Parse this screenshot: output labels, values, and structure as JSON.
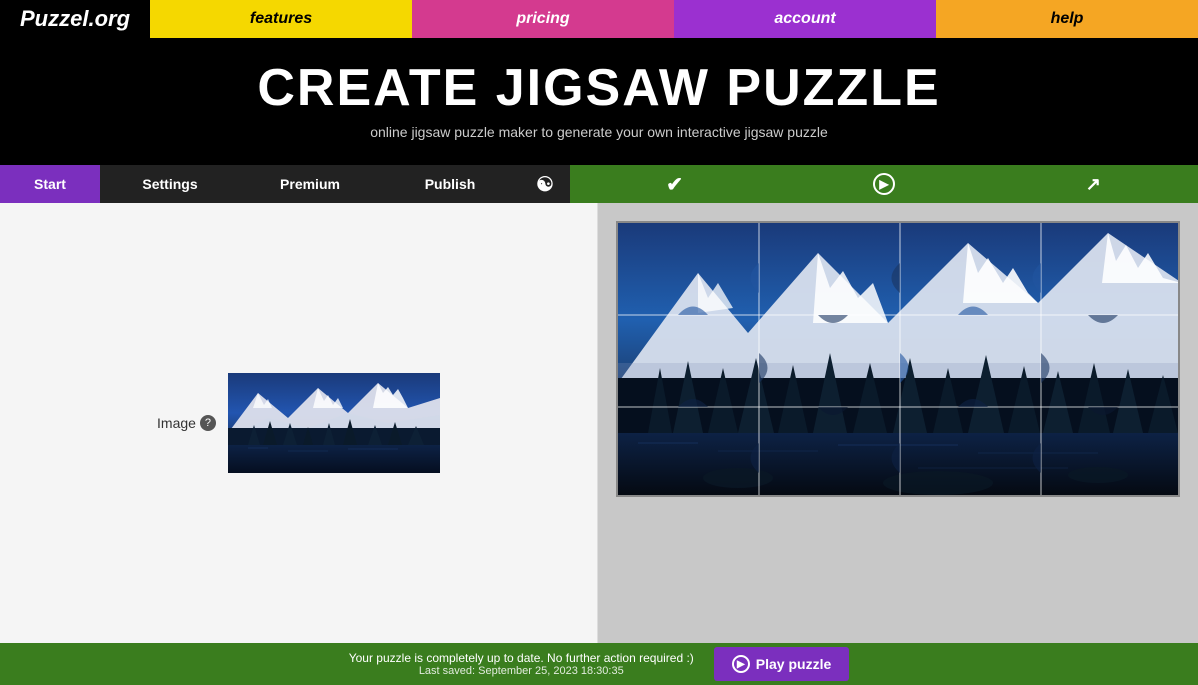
{
  "header": {
    "logo": "Puzzel.org",
    "nav": [
      {
        "id": "features",
        "label": "features",
        "bg": "#f5d800",
        "color": "#000"
      },
      {
        "id": "pricing",
        "label": "pricing",
        "bg": "#d43a8f",
        "color": "#fff"
      },
      {
        "id": "account",
        "label": "account",
        "bg": "#9b30d0",
        "color": "#fff"
      },
      {
        "id": "help",
        "label": "help",
        "bg": "#f5a623",
        "color": "#000"
      }
    ]
  },
  "hero": {
    "title": "CREATE JIGSAW PUZZLE",
    "subtitle": "online jigsaw puzzle maker to generate your own interactive jigsaw puzzle"
  },
  "tabs": {
    "start": "Start",
    "settings": "Settings",
    "premium": "Premium",
    "publish": "Publish"
  },
  "left": {
    "image_label": "Image",
    "image_tooltip": "?"
  },
  "status": {
    "message": "Your puzzle is completely up to date. No further action required :)",
    "saved": "Last saved: September 25, 2023 18:30:35",
    "play_button": "Play puzzle"
  }
}
